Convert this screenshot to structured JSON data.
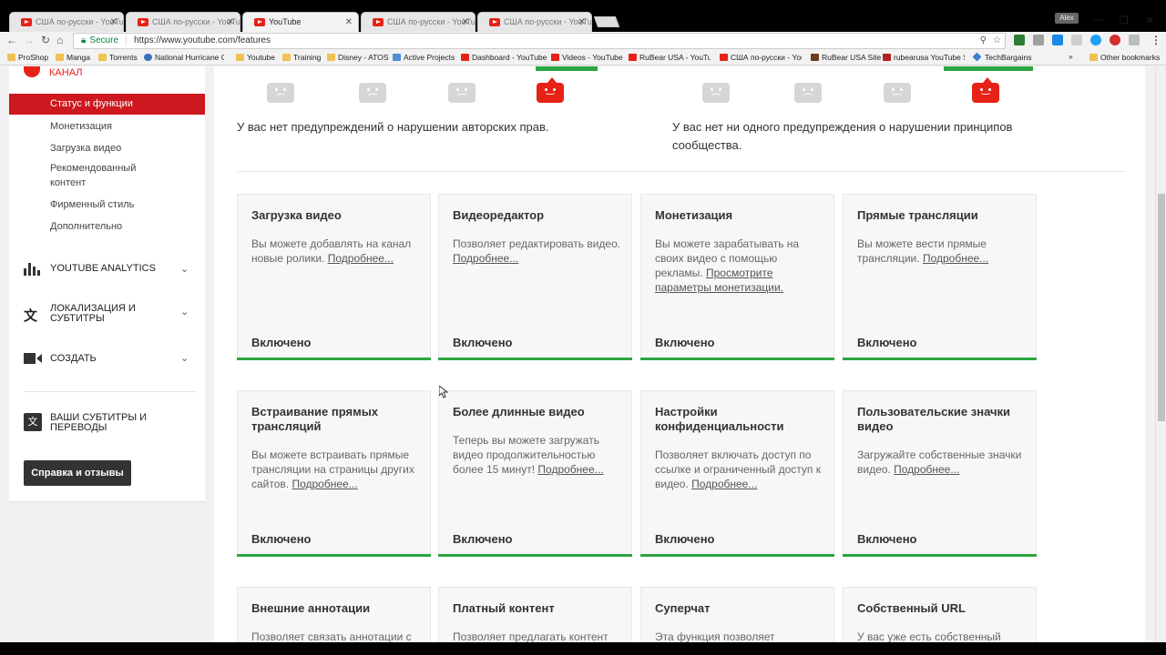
{
  "browser": {
    "tabs": [
      {
        "label": "США по-русски - YouTu",
        "active": false
      },
      {
        "label": "США по-русски - YouTu",
        "active": false
      },
      {
        "label": "YouTube",
        "active": true
      },
      {
        "label": "США по-русски - YouTu",
        "active": false
      },
      {
        "label": "США по-русски - YouTu",
        "active": false
      }
    ],
    "user_chip": "Alex",
    "secure_label": "Secure",
    "url": "https://www.youtube.com/features",
    "bookmarks": [
      "ProShop",
      "Manga",
      "Torrents",
      "National Hurricane Ce",
      "Youtube",
      "Training",
      "Disney - ATOS",
      "Active Projects",
      "Dashboard - YouTube",
      "Videos - YouTube",
      "RuBear USA - YouTub",
      "США по-русски - You",
      "RuBear USA Site",
      "rubearusa YouTube St",
      "TechBargains",
      "»",
      "Other bookmarks"
    ]
  },
  "sidebar": {
    "channel_label": "КАНАЛ",
    "active_item": "Статус и функции",
    "sub_items": [
      "Монетизация",
      "Загрузка видео",
      "Рекомендованный контент",
      "Фирменный стиль",
      "Дополнительно"
    ],
    "sections": [
      {
        "label": "YOUTUBE ANALYTICS"
      },
      {
        "label": "ЛОКАЛИЗАЦИЯ И СУБТИТРЫ"
      },
      {
        "label": "СОЗДАТЬ"
      },
      {
        "label": "ВАШИ СУБТИТРЫ И ПЕРЕВОДЫ"
      }
    ],
    "help_button": "Справка и отзывы"
  },
  "strikes": {
    "copyright_text": "У вас нет предупреждений о нарушении авторских прав.",
    "community_text": "У вас нет ни одного предупреждения о нарушении принципов сообщества."
  },
  "features": [
    {
      "title": "Загрузка видео",
      "desc": "Вы можете добавлять на канал новые ролики.",
      "more": "Подробнее...",
      "status": "Включено"
    },
    {
      "title": "Видеоредактор",
      "desc": "Позволяет редактировать видео.",
      "more": "Подробнее...",
      "status": "Включено"
    },
    {
      "title": "Монетизация",
      "desc": "Вы можете зарабатывать на своих видео с помощью рекламы.",
      "more": "Просмотрите параметры монетизации.",
      "status": "Включено"
    },
    {
      "title": "Прямые трансляции",
      "desc": "Вы можете вести прямые трансляции.",
      "more": "Подробнее...",
      "status": "Включено"
    },
    {
      "title": "Встраивание прямых трансляций",
      "desc": "Вы можете встраивать прямые трансляции на страницы других сайтов.",
      "more": "Подробнее...",
      "status": "Включено"
    },
    {
      "title": "Более длинные видео",
      "desc": "Теперь вы можете загружать видео продолжительностью более 15 минут!",
      "more": "Подробнее...",
      "status": "Включено"
    },
    {
      "title": "Настройки конфиденциальности",
      "desc": "Позволяет включать доступ по ссылке и ограниченный доступ к видео.",
      "more": "Подробнее...",
      "status": "Включено"
    },
    {
      "title": "Пользовательские значки видео",
      "desc": "Загружайте собственные значки видео.",
      "more": "Подробнее...",
      "status": "Включено"
    },
    {
      "title": "Внешние аннотации",
      "desc": "Позволяет связать аннотации с",
      "more": "",
      "status": ""
    },
    {
      "title": "Платный контент",
      "desc": "Позволяет предлагать контент",
      "more": "",
      "status": ""
    },
    {
      "title": "Суперчат",
      "desc": "Эта функция позволяет",
      "more": "",
      "status": ""
    },
    {
      "title": "Собственный URL",
      "desc": "У вас уже есть собственный",
      "more": "",
      "status": ""
    }
  ],
  "colors": {
    "accent_red": "#cc181e",
    "youtube_red": "#e62117",
    "enabled_green": "#2ba640"
  }
}
